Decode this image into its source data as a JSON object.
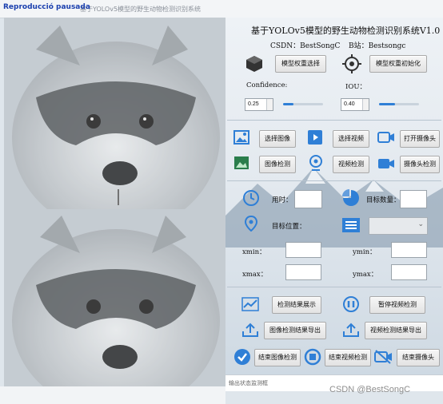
{
  "window": {
    "overlay_title": "Reproducció pausada",
    "faint_title": "基于YOLOv5模型的野生动物检测识别系统"
  },
  "header": {
    "title": "基于YOLOv5模型的野生动物检测识别系统V1.0",
    "csdn": "CSDN：BestSongC",
    "bilibili": "B站：Bestsongc"
  },
  "model": {
    "select_label": "模型权重选择",
    "init_label": "模型权重初始化"
  },
  "params": {
    "confidence_label": "Confidence:",
    "confidence_value": "0.25",
    "confidence_level": 0.25,
    "iou_label": "IOU：",
    "iou_value": "0.40",
    "iou_level": 0.4
  },
  "source": {
    "select_image": "选择图像",
    "select_video": "选择视频",
    "open_camera": "打开摄像头",
    "image_detect": "图像检测",
    "video_detect": "视频检测",
    "camera_detect": "摄像头检测"
  },
  "stats": {
    "time_label": "用时：",
    "count_label": "目标数量：",
    "position_label": "目标位置：",
    "xmin_label": "xmin：",
    "ymin_label": "ymin：",
    "xmax_label": "xmax：",
    "ymax_label": "ymax："
  },
  "actions": {
    "show_results": "检测结果展示",
    "pause_video": "暂停视频检测",
    "export_image": "图像检测结果导出",
    "export_video": "视频检测结果导出",
    "end_image": "结束图像检测",
    "end_video": "结束视频检测",
    "end_camera": "结束摄像头"
  },
  "status": {
    "placeholder": "输出状态监测框"
  },
  "watermark": "CSDN @BestSongC",
  "colors": {
    "accent": "#2f7fd6",
    "title_blue": "#1a3fae"
  }
}
